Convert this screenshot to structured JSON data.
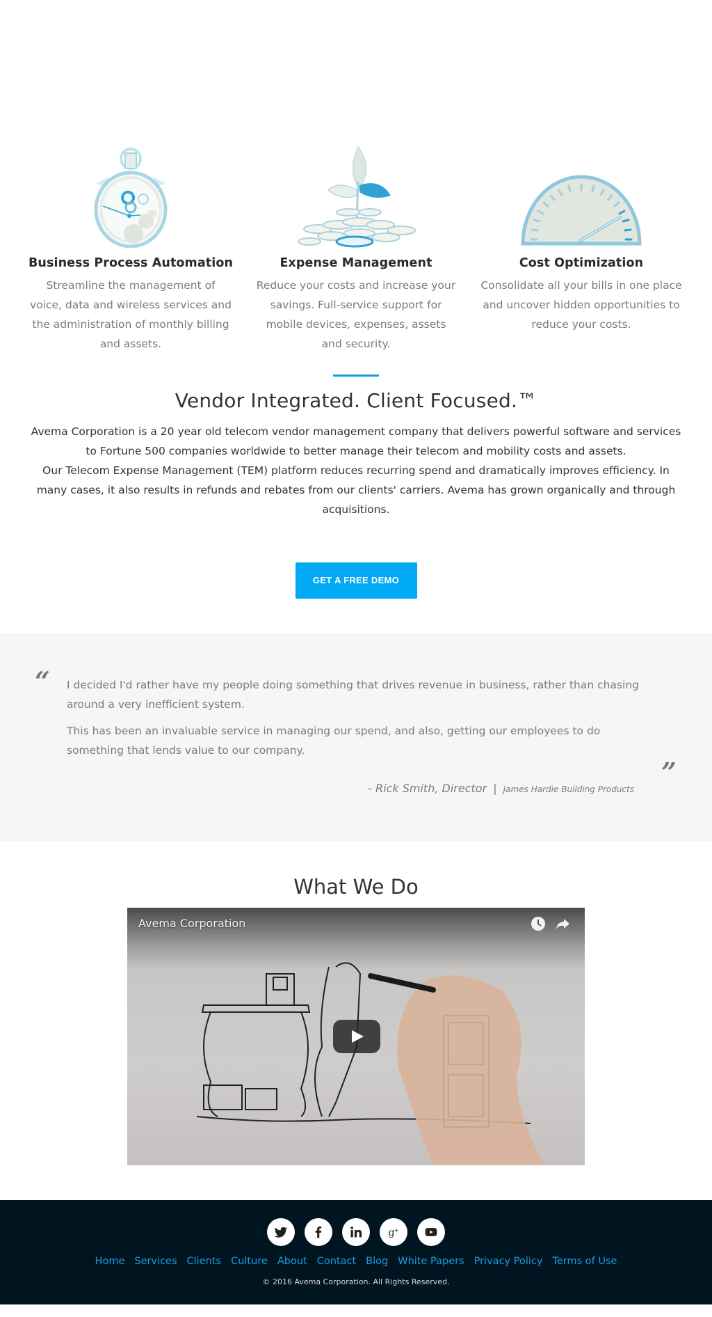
{
  "features": [
    {
      "icon": "stopwatch-icon",
      "title": "Business Process Automation",
      "text": "Streamline the management of voice, data and wireless services and the administration of monthly billing and assets."
    },
    {
      "icon": "money-plant-icon",
      "title": "Expense Management",
      "text": "Reduce your costs and increase your savings. Full-service support for mobile devices, expenses, assets and security."
    },
    {
      "icon": "speedometer-icon",
      "title": "Cost Optimization",
      "text": "Consolidate all your bills in one place and uncover hidden opportunities to reduce your costs."
    }
  ],
  "about": {
    "heading": "Vendor Integrated. Client Focused.™",
    "paragraph1": "Avema Corporation is a 20 year old telecom vendor management company that delivers powerful software and services to Fortune 500 companies worldwide to better manage their telecom and mobility costs and assets.",
    "paragraph2": "Our Telecom Expense Management (TEM) platform reduces recurring spend and dramatically improves efficiency. In many cases, it also results in refunds and rebates from our clients' carriers. Avema has grown organically and through acquisitions.",
    "cta_label": "GET A FREE DEMO"
  },
  "testimonial": {
    "open_quote": "“",
    "close_quote": "”",
    "lines": [
      "I decided I'd rather have my people doing something that drives revenue in business, rather than chasing around a very inefficient system.",
      "This has been an invaluable service in managing our spend, and also, getting our employees to do something that lends value to our company."
    ],
    "author": "- Rick Smith, Director",
    "separator": "|",
    "company": "James Hardie Building Products"
  },
  "what_we_do": {
    "heading": "What We Do",
    "video": {
      "title": "Avema Corporation",
      "icons": [
        "watch-later-icon",
        "share-icon",
        "play-icon"
      ]
    }
  },
  "footer": {
    "socials": [
      "twitter",
      "facebook",
      "linkedin",
      "google-plus",
      "youtube"
    ],
    "links": [
      "Home",
      "Services",
      "Clients",
      "Culture",
      "About",
      "Contact",
      "Blog",
      "White Papers",
      "Privacy Policy",
      "Terms of Use"
    ],
    "copyright": "© 2016 Avema Corporation. All Rights Reserved."
  },
  "colors": {
    "accent": "#00a9f4",
    "divider": "#0fa0dc",
    "footer_bg": "#001520",
    "footer_link": "#1a9be0",
    "testimonial_bg": "#f6f6f6"
  }
}
